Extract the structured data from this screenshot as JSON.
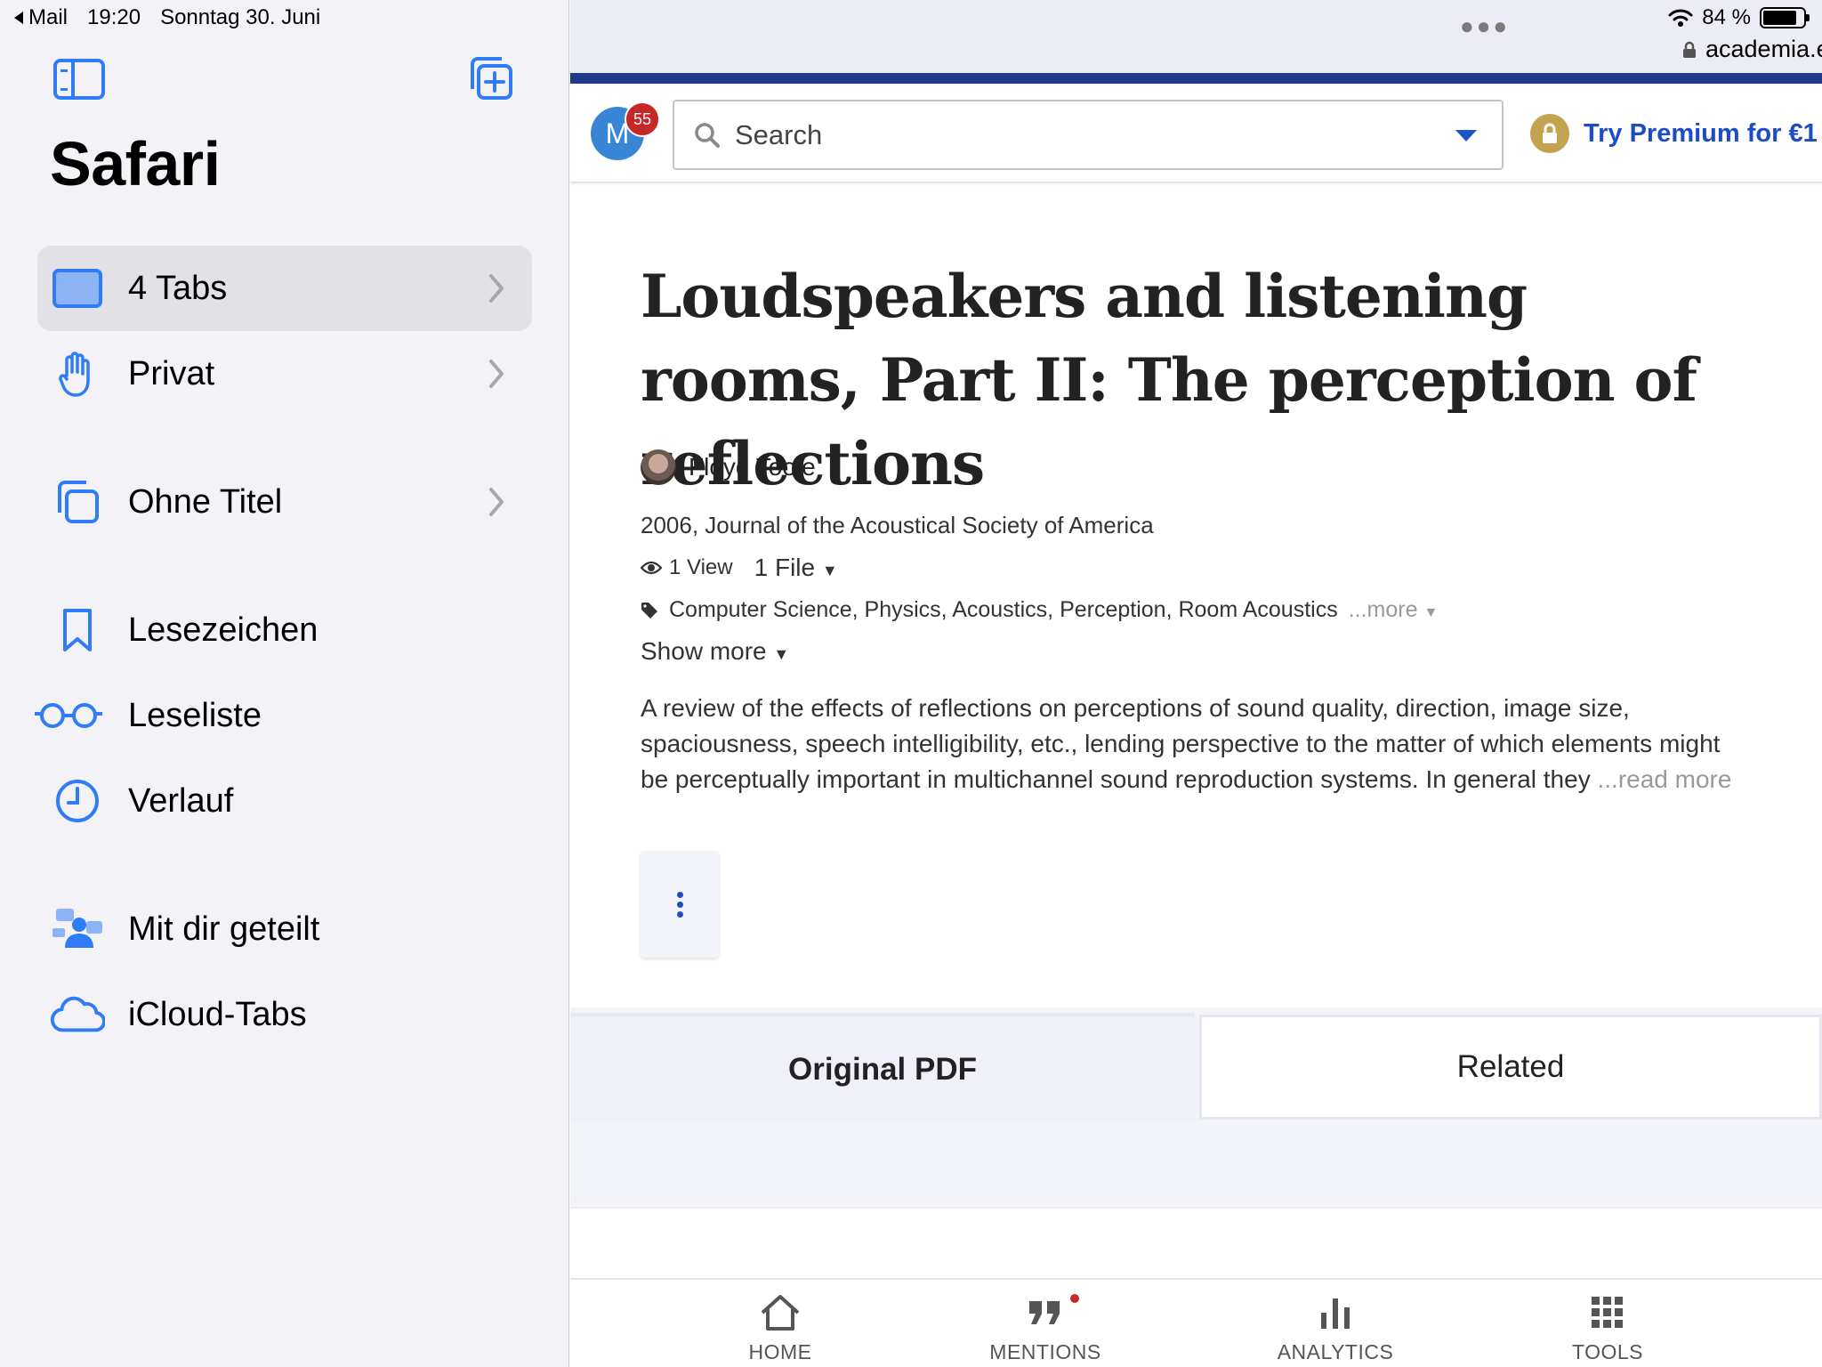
{
  "status_bar": {
    "back_app": "Mail",
    "time": "19:20",
    "date": "Sonntag 30. Juni",
    "battery": "84 %"
  },
  "sidebar": {
    "title": "Safari",
    "items": [
      {
        "label": "4 Tabs",
        "icon": "tabs-icon",
        "selected": true
      },
      {
        "label": "Privat",
        "icon": "hand-icon"
      },
      {
        "label": "Ohne Titel",
        "icon": "tab-group-icon"
      },
      {
        "label": "Lesezeichen",
        "icon": "bookmark-icon"
      },
      {
        "label": "Leseliste",
        "icon": "glasses-icon"
      },
      {
        "label": "Verlauf",
        "icon": "clock-icon"
      },
      {
        "label": "Mit dir geteilt",
        "icon": "shared-people-icon"
      },
      {
        "label": "iCloud-Tabs",
        "icon": "cloud-icon"
      }
    ]
  },
  "browser": {
    "url": "academia.edu"
  },
  "header": {
    "avatar_letter": "M",
    "notification_count": "55",
    "search_placeholder": "Search",
    "premium_label": "Try Premium for €1"
  },
  "paper": {
    "title": "Loudspeakers and listening rooms, Part II: The perception of reflections",
    "author": "Floyd Toole",
    "publication": "2006, Journal of the Acoustical Society of America",
    "views": "1 View",
    "files": "1 File",
    "tags": "Computer Science, Physics, Acoustics, Perception, Room Acoustics",
    "tags_more": "...more",
    "show_more": "Show more",
    "abstract": "A review of the effects of reflections on perceptions of sound quality, direction, image size, spaciousness, speech intelligibility, etc., lending perspective to the matter of which elements might be perceptually important in multichannel sound reproduction systems. In general they",
    "read_more": "...read more"
  },
  "tabs": {
    "original": "Original PDF",
    "related": "Related"
  },
  "bottom_nav": [
    {
      "label": "HOME",
      "icon": "home-icon"
    },
    {
      "label": "MENTIONS",
      "icon": "quote-icon",
      "dot": true
    },
    {
      "label": "ANALYTICS",
      "icon": "bar-chart-icon"
    },
    {
      "label": "TOOLS",
      "icon": "grid-icon"
    }
  ],
  "colors": {
    "ios_blue": "#2f7cf6",
    "academia_navy": "#1d3a8a",
    "academia_link": "#1d4cc4",
    "premium_gold": "#c3a250",
    "badge_red": "#c62828"
  }
}
